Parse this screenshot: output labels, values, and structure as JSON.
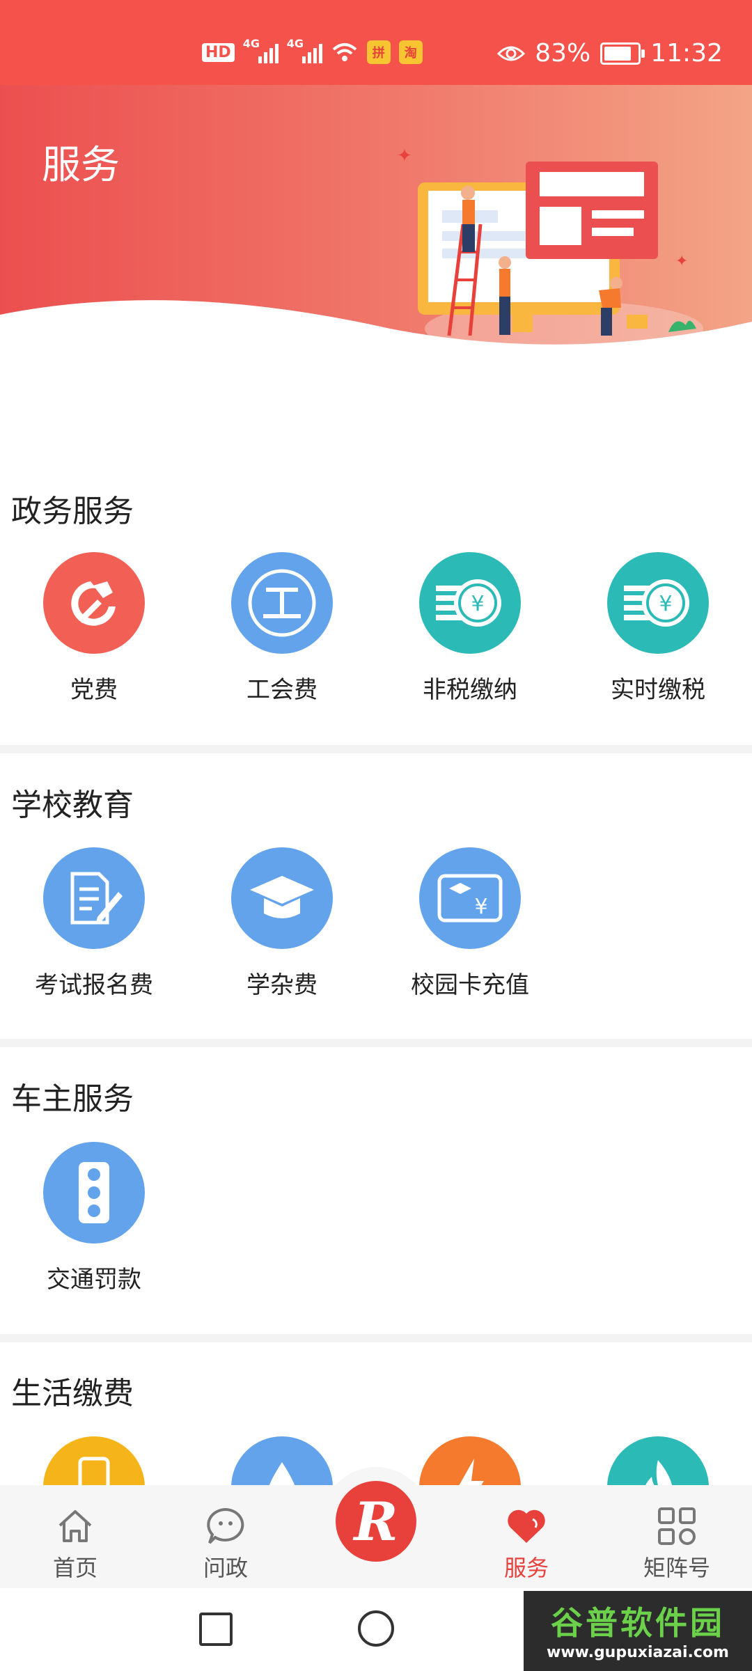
{
  "status_bar": {
    "hd": "HD",
    "network_1": "4G",
    "network_2": "4G",
    "app_1": "拼",
    "app_2": "淘",
    "battery_percent": "83%",
    "battery_level": 0.83,
    "time": "11:32"
  },
  "header": {
    "title": "服务"
  },
  "sections": [
    {
      "title": "政务服务",
      "items": [
        {
          "label": "党费",
          "icon": "hammer-sickle-icon",
          "color": "#f26055"
        },
        {
          "label": "工会费",
          "icon": "union-icon",
          "color": "#62a3ec"
        },
        {
          "label": "非税缴纳",
          "icon": "coin-stack-icon",
          "color": "#2cbab7"
        },
        {
          "label": "实时缴税",
          "icon": "coin-stack-icon",
          "color": "#2cbab7"
        }
      ]
    },
    {
      "title": "学校教育",
      "items": [
        {
          "label": "考试报名费",
          "icon": "document-pen-icon",
          "color": "#62a3ec"
        },
        {
          "label": "学杂费",
          "icon": "graduation-cap-icon",
          "color": "#62a3ec"
        },
        {
          "label": "校园卡充值",
          "icon": "campus-card-icon",
          "color": "#62a3ec"
        }
      ]
    },
    {
      "title": "车主服务",
      "items": [
        {
          "label": "交通罚款",
          "icon": "traffic-light-icon",
          "color": "#62a3ec"
        }
      ]
    },
    {
      "title": "生活缴费",
      "items": [
        {
          "label": "",
          "icon": "phone-icon",
          "color": "#f5b51a"
        },
        {
          "label": "",
          "icon": "water-drop-icon",
          "color": "#62a3ec"
        },
        {
          "label": "",
          "icon": "lightning-icon",
          "color": "#f57a2e"
        },
        {
          "label": "",
          "icon": "flame-icon",
          "color": "#2cbab7"
        }
      ]
    }
  ],
  "bottom_nav": [
    {
      "label": "首页",
      "icon": "home-icon"
    },
    {
      "label": "问政",
      "icon": "chat-icon"
    },
    {
      "label": "",
      "icon": "app-logo-icon",
      "logo_letter": "R"
    },
    {
      "label": "服务",
      "icon": "heart-icon",
      "active": true
    },
    {
      "label": "矩阵号",
      "icon": "grid-icon"
    }
  ],
  "watermark": {
    "line1": "谷普软件园",
    "line2": "www.gupuxiazai.com"
  },
  "colors": {
    "brand": "#e8403a",
    "statusbar": "#f4524a"
  }
}
